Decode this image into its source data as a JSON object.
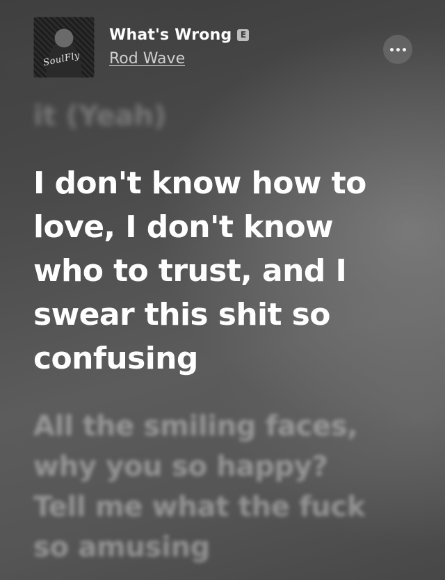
{
  "now_playing": {
    "song_title": "What's Wrong",
    "explicit_badge": "E",
    "artist": "Rod Wave",
    "album_art_text": "SoulFly"
  },
  "icons": {
    "more_button": "ellipsis-icon",
    "explicit": "explicit-badge"
  },
  "lyrics": {
    "previous": [
      "it (Yeah)"
    ],
    "current": [
      "I don't know how to",
      "love, I don't know",
      "who to trust, and I",
      "swear this shit so",
      "confusing"
    ],
    "next": [
      "All the smiling faces,",
      "why you so happy?",
      "Tell me what the fuck",
      "so amusing"
    ]
  }
}
